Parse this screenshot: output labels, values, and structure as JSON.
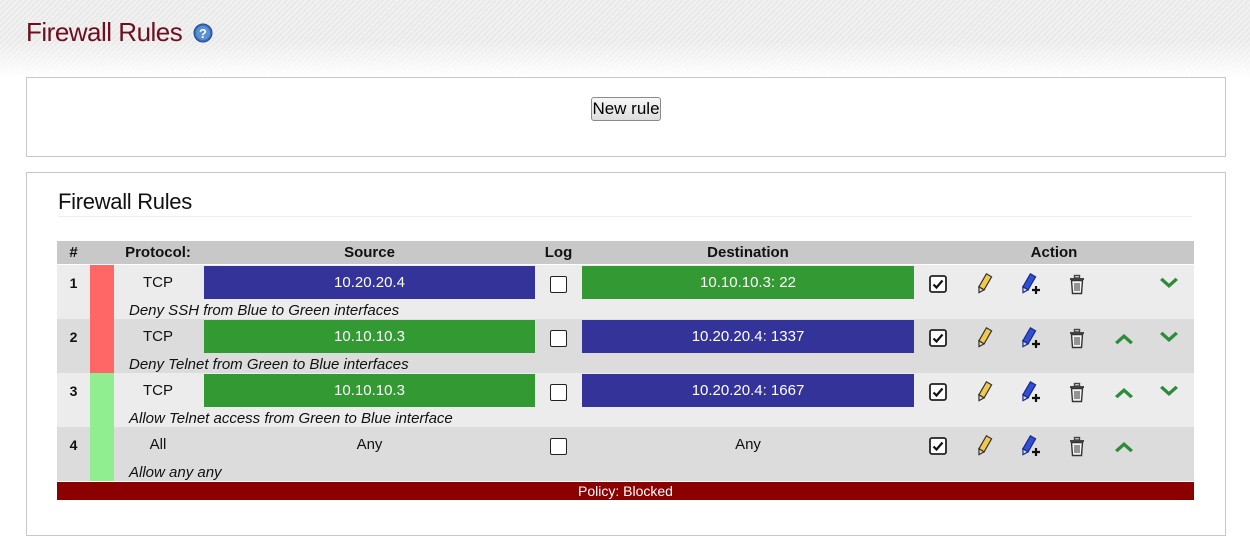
{
  "page": {
    "title": "Firewall Rules",
    "help_icon": "help-icon"
  },
  "toolbar": {
    "new_rule_label": "New rule"
  },
  "section": {
    "title": "Firewall Rules"
  },
  "table": {
    "headers": {
      "num": "#",
      "protocol": "Protocol:",
      "source": "Source",
      "log": "Log",
      "destination": "Destination",
      "action": "Action"
    },
    "rows": [
      {
        "num": "1",
        "status": "deny",
        "status_color": "#ff6666",
        "protocol": "TCP",
        "source": "10.20.20.4",
        "source_color": "#333399",
        "log": false,
        "destination": "10.10.10.3: 22",
        "destination_color": "#339933",
        "remark": "Deny SSH from Blue to Green interfaces",
        "enabled": true,
        "can_move_up": false,
        "can_move_down": true
      },
      {
        "num": "2",
        "status": "deny",
        "status_color": "#ff6666",
        "protocol": "TCP",
        "source": "10.10.10.3",
        "source_color": "#339933",
        "log": false,
        "destination": "10.20.20.4: 1337",
        "destination_color": "#333399",
        "remark": "Deny Telnet from Green to Blue interfaces",
        "enabled": true,
        "can_move_up": true,
        "can_move_down": true
      },
      {
        "num": "3",
        "status": "allow",
        "status_color": "#90ee90",
        "protocol": "TCP",
        "source": "10.10.10.3",
        "source_color": "#339933",
        "log": false,
        "destination": "10.20.20.4: 1667",
        "destination_color": "#333399",
        "remark": "Allow Telnet access from Green to Blue interface",
        "enabled": true,
        "can_move_up": true,
        "can_move_down": true
      },
      {
        "num": "4",
        "status": "allow",
        "status_color": "#90ee90",
        "protocol": "All",
        "source": "Any",
        "source_color": "",
        "log": false,
        "destination": "Any",
        "destination_color": "",
        "remark": "Allow any any",
        "enabled": true,
        "can_move_up": true,
        "can_move_down": false
      }
    ],
    "action_icons": [
      "checkbox-checked-icon",
      "pencil-edit-icon",
      "pencil-copy-icon",
      "trash-icon",
      "arrow-up-icon",
      "arrow-down-icon"
    ]
  },
  "footer": {
    "policy": "Policy: Blocked",
    "policy_color": "#8b0000"
  },
  "colors": {
    "title": "#6d0f1e",
    "header_row": "#c8c8c8",
    "row_even": "#dcdcdc",
    "row_odd": "#ececec",
    "arrow": "#2e8b3a"
  }
}
